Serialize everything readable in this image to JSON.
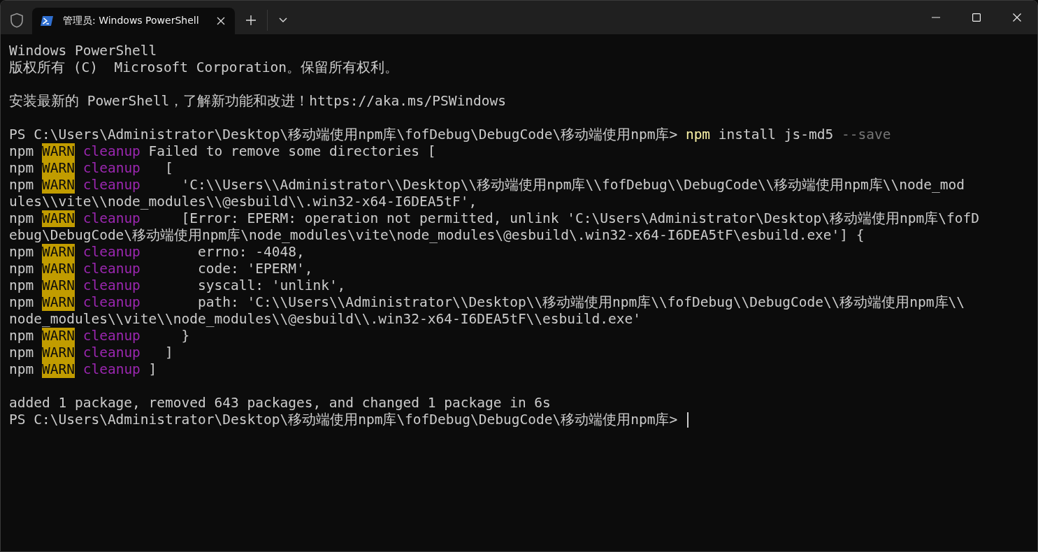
{
  "window": {
    "tab_title": "管理员: Windows PowerShell"
  },
  "terminal": {
    "blocks": [
      {
        "lines": [
          {
            "segments": [
              {
                "kind": "text",
                "text": "Windows PowerShell"
              }
            ]
          },
          {
            "segments": [
              {
                "kind": "text",
                "text": "版权所有 (C)  Microsoft Corporation。保留所有权利。"
              }
            ]
          }
        ]
      },
      {
        "lines": [
          {
            "segments": [
              {
                "kind": "text",
                "text": "安装最新的 PowerShell，了解新功能和改进！https://aka.ms/PSWindows"
              }
            ]
          }
        ]
      },
      {
        "lines": [
          {
            "segments": [
              {
                "kind": "prompt",
                "text": "PS C:\\Users\\Administrator\\Desktop\\移动端使用npm库\\fofDebug\\DebugCode\\移动端使用npm库> "
              },
              {
                "kind": "cmd",
                "text": "npm"
              },
              {
                "kind": "arg",
                "text": " install js-md5 "
              },
              {
                "kind": "flag",
                "text": "--save"
              }
            ]
          },
          {
            "segments": [
              {
                "kind": "text",
                "text": "npm "
              },
              {
                "kind": "warn",
                "text": "WARN"
              },
              {
                "kind": "tag",
                "text": " cleanup"
              },
              {
                "kind": "text",
                "text": " Failed to remove some directories ["
              }
            ]
          },
          {
            "segments": [
              {
                "kind": "text",
                "text": "npm "
              },
              {
                "kind": "warn",
                "text": "WARN"
              },
              {
                "kind": "tag",
                "text": " cleanup"
              },
              {
                "kind": "text",
                "text": "   ["
              }
            ]
          },
          {
            "segments": [
              {
                "kind": "text",
                "text": "npm "
              },
              {
                "kind": "warn",
                "text": "WARN"
              },
              {
                "kind": "tag",
                "text": " cleanup"
              },
              {
                "kind": "text",
                "text": "     'C:\\\\Users\\\\Administrator\\\\Desktop\\\\移动端使用npm库\\\\fofDebug\\\\DebugCode\\\\移动端使用npm库\\\\node_mod"
              }
            ]
          },
          {
            "segments": [
              {
                "kind": "text",
                "text": "ules\\\\vite\\\\node_modules\\\\@esbuild\\\\.win32-x64-I6DEA5tF',"
              }
            ]
          },
          {
            "segments": [
              {
                "kind": "text",
                "text": "npm "
              },
              {
                "kind": "warn",
                "text": "WARN"
              },
              {
                "kind": "tag",
                "text": " cleanup"
              },
              {
                "kind": "text",
                "text": "     [Error: EPERM: operation not permitted, unlink 'C:\\Users\\Administrator\\Desktop\\移动端使用npm库\\fofD"
              }
            ]
          },
          {
            "segments": [
              {
                "kind": "text",
                "text": "ebug\\DebugCode\\移动端使用npm库\\node_modules\\vite\\node_modules\\@esbuild\\.win32-x64-I6DEA5tF\\esbuild.exe'] {"
              }
            ]
          },
          {
            "segments": [
              {
                "kind": "text",
                "text": "npm "
              },
              {
                "kind": "warn",
                "text": "WARN"
              },
              {
                "kind": "tag",
                "text": " cleanup"
              },
              {
                "kind": "text",
                "text": "       errno: -4048,"
              }
            ]
          },
          {
            "segments": [
              {
                "kind": "text",
                "text": "npm "
              },
              {
                "kind": "warn",
                "text": "WARN"
              },
              {
                "kind": "tag",
                "text": " cleanup"
              },
              {
                "kind": "text",
                "text": "       code: 'EPERM',"
              }
            ]
          },
          {
            "segments": [
              {
                "kind": "text",
                "text": "npm "
              },
              {
                "kind": "warn",
                "text": "WARN"
              },
              {
                "kind": "tag",
                "text": " cleanup"
              },
              {
                "kind": "text",
                "text": "       syscall: 'unlink',"
              }
            ]
          },
          {
            "segments": [
              {
                "kind": "text",
                "text": "npm "
              },
              {
                "kind": "warn",
                "text": "WARN"
              },
              {
                "kind": "tag",
                "text": " cleanup"
              },
              {
                "kind": "text",
                "text": "       path: 'C:\\\\Users\\\\Administrator\\\\Desktop\\\\移动端使用npm库\\\\fofDebug\\\\DebugCode\\\\移动端使用npm库\\\\"
              }
            ]
          },
          {
            "segments": [
              {
                "kind": "text",
                "text": "node_modules\\\\vite\\\\node_modules\\\\@esbuild\\\\.win32-x64-I6DEA5tF\\\\esbuild.exe'"
              }
            ]
          },
          {
            "segments": [
              {
                "kind": "text",
                "text": "npm "
              },
              {
                "kind": "warn",
                "text": "WARN"
              },
              {
                "kind": "tag",
                "text": " cleanup"
              },
              {
                "kind": "text",
                "text": "     }"
              }
            ]
          },
          {
            "segments": [
              {
                "kind": "text",
                "text": "npm "
              },
              {
                "kind": "warn",
                "text": "WARN"
              },
              {
                "kind": "tag",
                "text": " cleanup"
              },
              {
                "kind": "text",
                "text": "   ]"
              }
            ]
          },
          {
            "segments": [
              {
                "kind": "text",
                "text": "npm "
              },
              {
                "kind": "warn",
                "text": "WARN"
              },
              {
                "kind": "tag",
                "text": " cleanup"
              },
              {
                "kind": "text",
                "text": " ]"
              }
            ]
          }
        ]
      },
      {
        "lines": [
          {
            "segments": [
              {
                "kind": "text",
                "text": "added 1 package, removed 643 packages, and changed 1 package in 6s"
              }
            ]
          },
          {
            "segments": [
              {
                "kind": "prompt",
                "text": "PS C:\\Users\\Administrator\\Desktop\\移动端使用npm库\\fofDebug\\DebugCode\\移动端使用npm库> "
              }
            ],
            "cursor": true
          }
        ]
      }
    ]
  }
}
